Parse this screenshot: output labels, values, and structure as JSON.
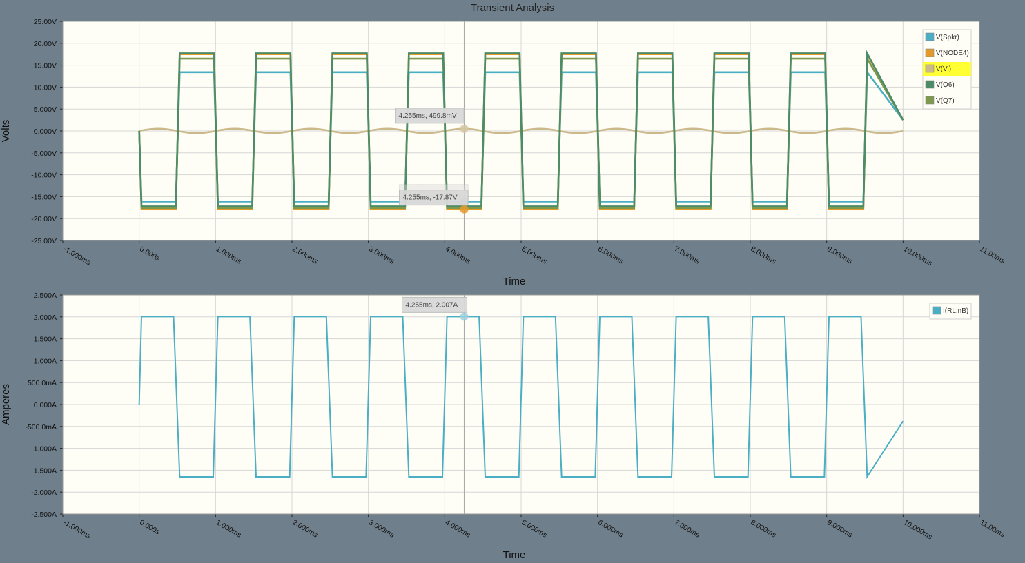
{
  "window": {
    "title": "Transient Analysis"
  },
  "colors": {
    "background": "#6f7f8b",
    "plot_bg": "#fffef6",
    "grid": "#d6d6d6",
    "spkr": "#4aaec4",
    "node4": "#e39a2b",
    "vi": "#cbb98a",
    "q6": "#4c8c68",
    "q7": "#7d9a4c",
    "irl": "#4aaec4",
    "legend_highlight": "#ffff33"
  },
  "chart_data": [
    {
      "type": "line",
      "title": "Transient Analysis",
      "xlabel": "Time",
      "ylabel": "Volts",
      "xlim": [
        -1.0,
        11.0
      ],
      "ylim": [
        -25.0,
        25.0
      ],
      "x_unit": "ms",
      "x_ticks": [
        "-1.000ms",
        "0.000s",
        "1.000ms",
        "2.000ms",
        "3.000ms",
        "4.000ms",
        "5.000ms",
        "6.000ms",
        "7.000ms",
        "8.000ms",
        "9.000ms",
        "10.000ms",
        "11.00ms"
      ],
      "y_ticks": [
        "25.00V",
        "20.00V",
        "15.00V",
        "10.00V",
        "5.000V",
        "0.000V",
        "-5.000V",
        "-10.00V",
        "-15.00V",
        "-20.00V",
        "-25.00V"
      ],
      "legend_position": "top-right",
      "grid": true,
      "series": [
        {
          "name": "V(Spkr)",
          "color_key": "spkr",
          "waveform": "square",
          "high": 13.4,
          "low": -16.1,
          "period_ms": 1.0
        },
        {
          "name": "V(NODE4)",
          "color_key": "node4",
          "waveform": "square",
          "high": 17.5,
          "low": -17.87,
          "period_ms": 1.0
        },
        {
          "name": "V(Vi)",
          "color_key": "vi",
          "waveform": "sine",
          "amplitude": 0.5,
          "period_ms": 1.0,
          "highlighted": true
        },
        {
          "name": "V(Q6)",
          "color_key": "q6",
          "waveform": "square",
          "high": 17.7,
          "low": -17.2,
          "period_ms": 1.0
        },
        {
          "name": "V(Q7)",
          "color_key": "q7",
          "waveform": "square",
          "high": 16.5,
          "low": -17.6,
          "period_ms": 1.0
        }
      ],
      "cursor_x_ms": 4.255,
      "annotations": [
        {
          "text": "4.255ms, 499.8mV",
          "x_ms": 4.255,
          "y": 0.4998
        },
        {
          "text": "4.255ms, -16.32V",
          "x_ms": 4.255,
          "y": -16.32,
          "faded": true
        },
        {
          "text": "4.255ms, -17.87V",
          "x_ms": 4.255,
          "y": -17.87
        }
      ]
    },
    {
      "type": "line",
      "xlabel": "Time",
      "ylabel": "Amperes",
      "xlim": [
        -1.0,
        11.0
      ],
      "ylim": [
        -2.5,
        2.5
      ],
      "x_unit": "ms",
      "x_ticks": [
        "-1.000ms",
        "0.000s",
        "1.000ms",
        "2.000ms",
        "3.000ms",
        "4.000ms",
        "5.000ms",
        "6.000ms",
        "7.000ms",
        "8.000ms",
        "9.000ms",
        "10.000ms",
        "11.00ms"
      ],
      "y_ticks": [
        "2.500A",
        "2.000A",
        "1.500A",
        "1.000A",
        "500.0mA",
        "0.000A",
        "-500.0mA",
        "-1.000A",
        "-1.500A",
        "-2.000A",
        "-2.500A"
      ],
      "legend_position": "top-right",
      "grid": true,
      "series": [
        {
          "name": "I(RL.nB)",
          "color_key": "irl",
          "waveform": "square",
          "high": 2.007,
          "low": -1.65,
          "period_ms": 1.0,
          "end_value": -0.38
        }
      ],
      "cursor_x_ms": 4.255,
      "annotations": [
        {
          "text": "4.255ms, 2.007A",
          "x_ms": 4.255,
          "y": 2.007
        }
      ]
    }
  ]
}
